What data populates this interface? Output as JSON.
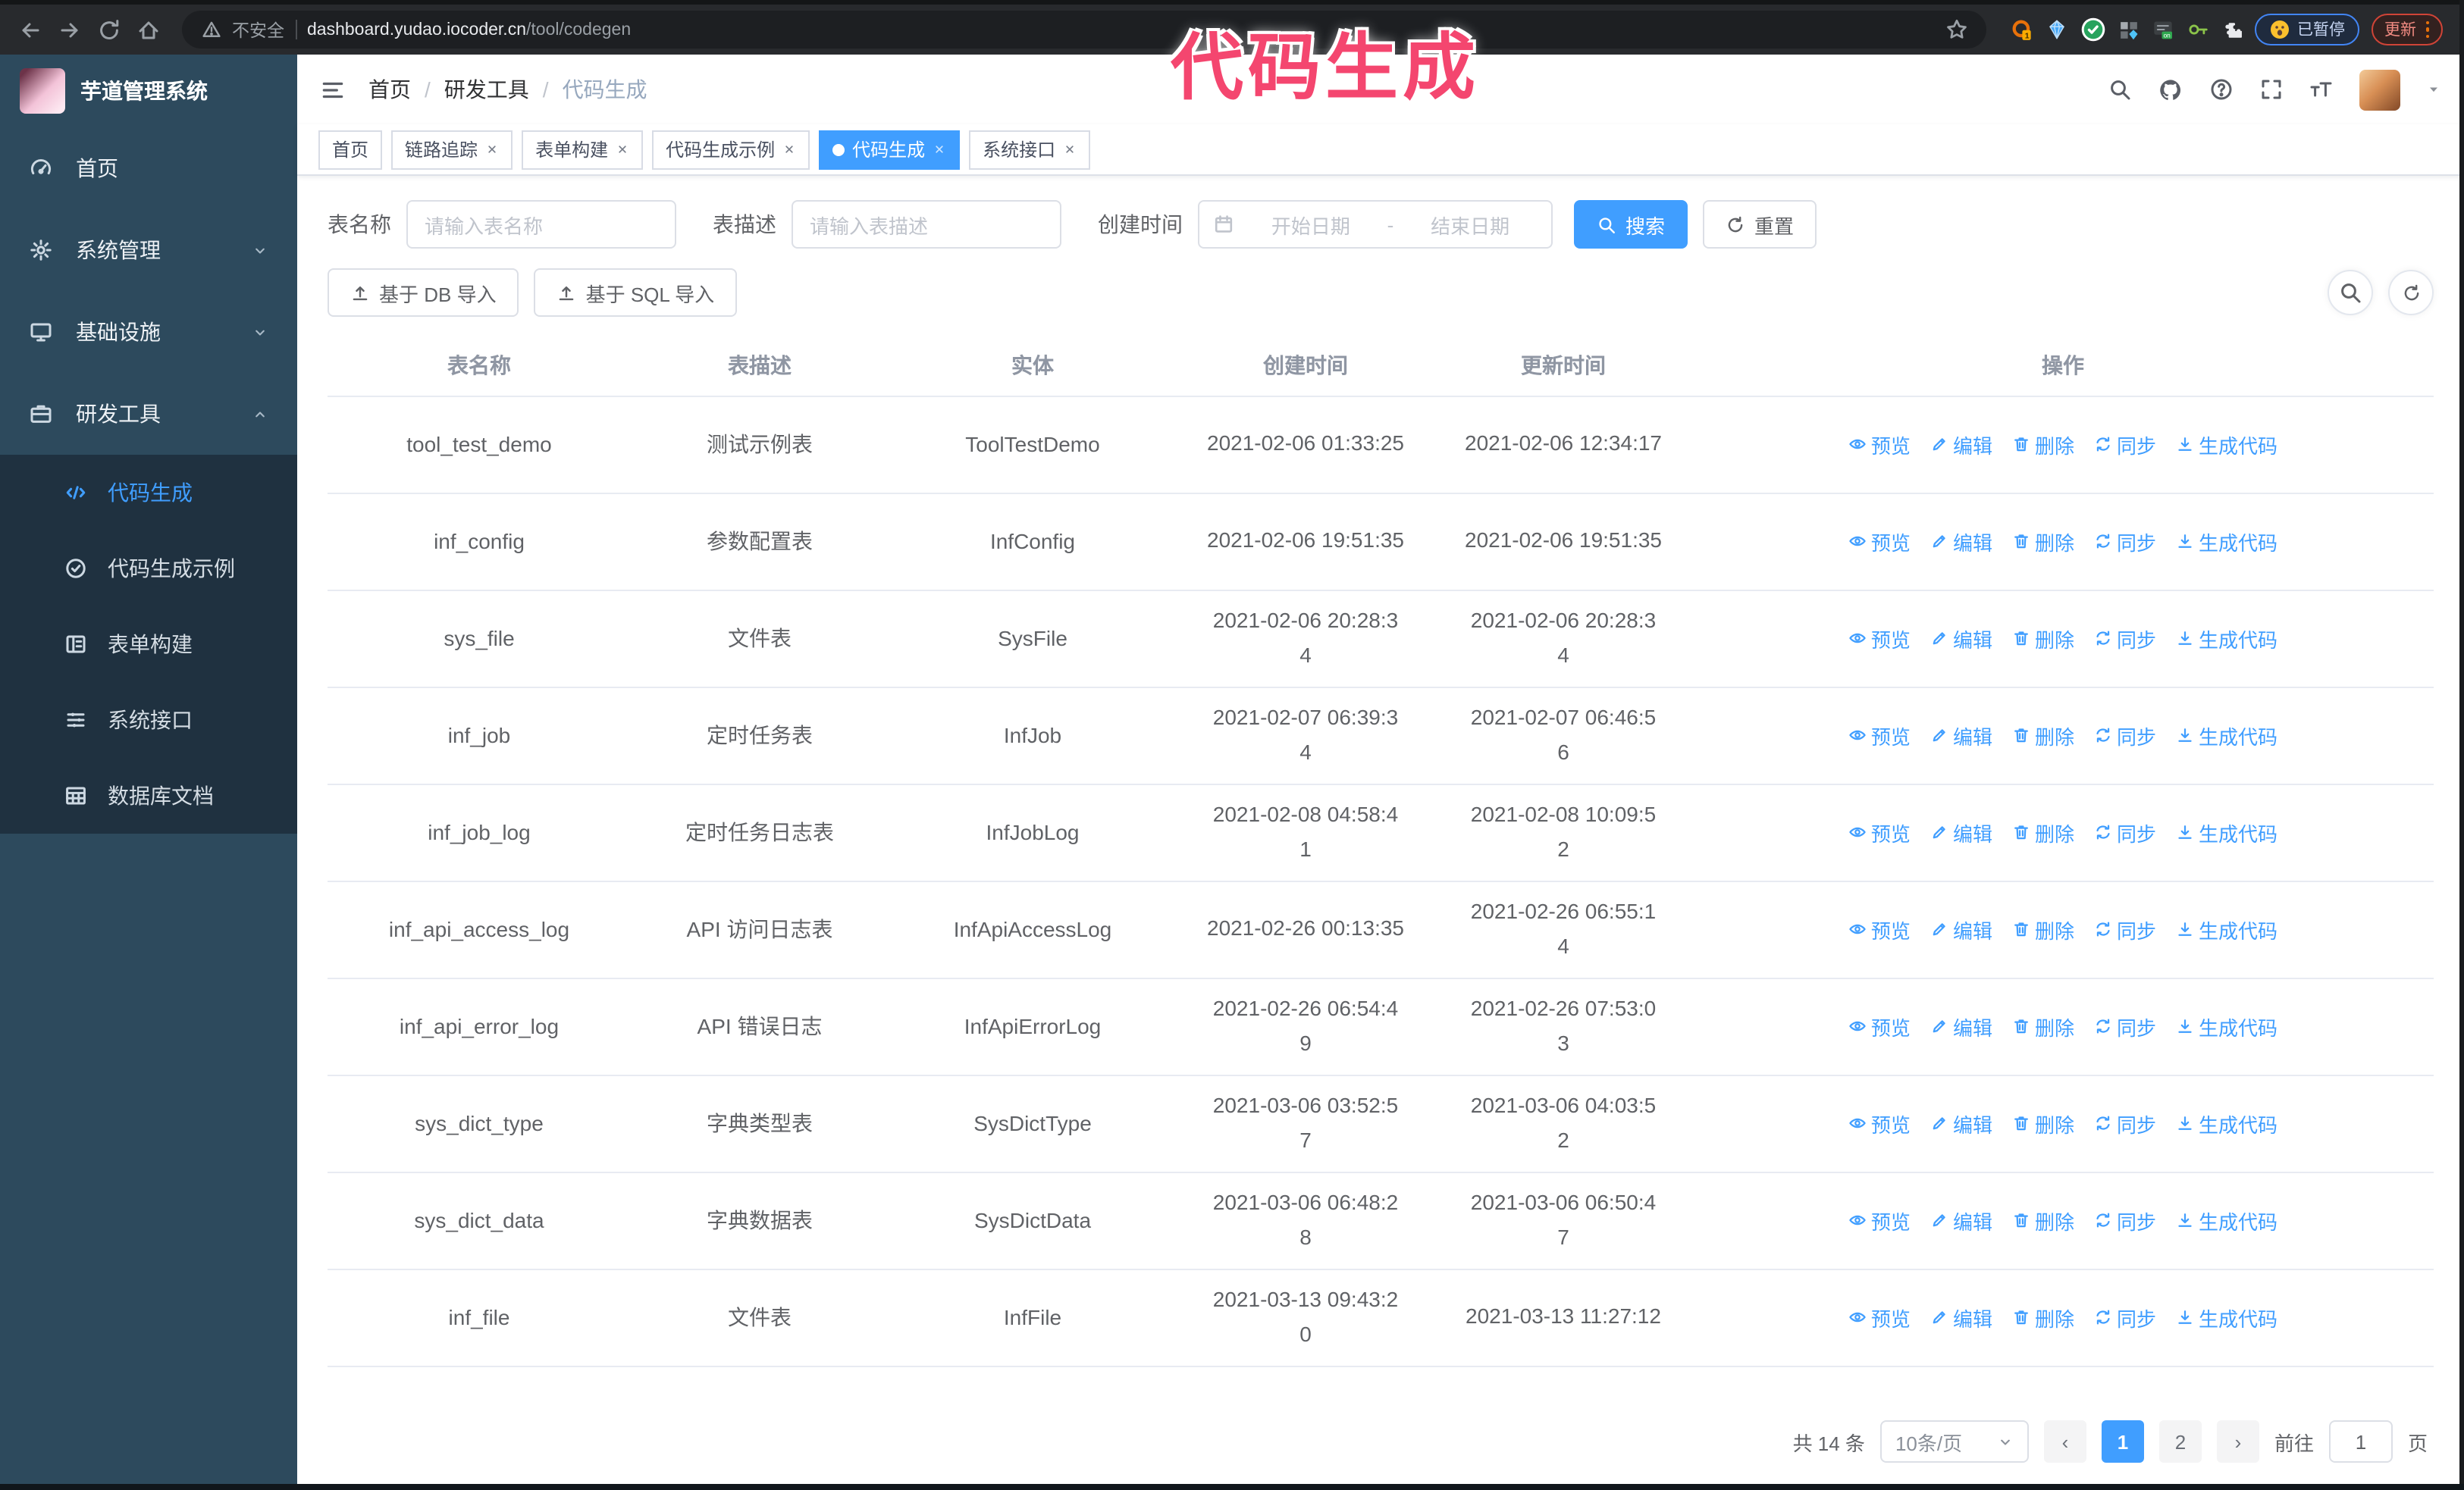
{
  "theme": {
    "primary": "#409eff",
    "annotation": "#f4466f",
    "sidebar_bg": "#2d4a5d",
    "submenu_bg": "#1f3140"
  },
  "annotation": {
    "text": "代码生成"
  },
  "browser": {
    "security_label": "不安全",
    "url_domain": "dashboard.yudao.iocoder.cn",
    "url_path": "/tool/codegen",
    "extension_badge": "1",
    "on_badge": "on",
    "paused_label": "已暂停",
    "update_label": "更新"
  },
  "sidebar": {
    "logo_title": "芋道管理系统",
    "items": [
      {
        "label": "首页",
        "icon": "gauge-icon",
        "chevron": ""
      },
      {
        "label": "系统管理",
        "icon": "gear-icon",
        "chevron": "down"
      },
      {
        "label": "基础设施",
        "icon": "monitor-icon",
        "chevron": "down"
      },
      {
        "label": "研发工具",
        "icon": "briefcase-icon",
        "chevron": "up"
      }
    ],
    "submenu": [
      {
        "label": "代码生成",
        "icon": "code-icon",
        "active": true
      },
      {
        "label": "代码生成示例",
        "icon": "badge-check-icon",
        "active": false
      },
      {
        "label": "表单构建",
        "icon": "form-icon",
        "active": false
      },
      {
        "label": "系统接口",
        "icon": "api-list-icon",
        "active": false
      },
      {
        "label": "数据库文档",
        "icon": "table-grid-icon",
        "active": false
      }
    ]
  },
  "header": {
    "breadcrumb": [
      "首页",
      "研发工具",
      "代码生成"
    ]
  },
  "tabs": [
    {
      "label": "首页",
      "closable": false,
      "active": false
    },
    {
      "label": "链路追踪",
      "closable": true,
      "active": false
    },
    {
      "label": "表单构建",
      "closable": true,
      "active": false
    },
    {
      "label": "代码生成示例",
      "closable": true,
      "active": false
    },
    {
      "label": "代码生成",
      "closable": true,
      "active": true
    },
    {
      "label": "系统接口",
      "closable": true,
      "active": false
    }
  ],
  "filters": {
    "table_name_label": "表名称",
    "table_name_placeholder": "请输入表名称",
    "table_desc_label": "表描述",
    "table_desc_placeholder": "请输入表描述",
    "create_time_label": "创建时间",
    "date_start_placeholder": "开始日期",
    "date_separator": "-",
    "date_end_placeholder": "结束日期",
    "search_label": "搜索",
    "reset_label": "重置"
  },
  "toolbar": {
    "import_db_label": "基于 DB 导入",
    "import_sql_label": "基于 SQL 导入"
  },
  "table": {
    "columns": [
      "表名称",
      "表描述",
      "实体",
      "创建时间",
      "更新时间",
      "操作"
    ],
    "action_labels": [
      "预览",
      "编辑",
      "删除",
      "同步",
      "生成代码"
    ],
    "rows": [
      {
        "name": "tool_test_demo",
        "desc": "测试示例表",
        "entity": "ToolTestDemo",
        "create_time": "2021-02-06 01:33:25",
        "update_time": "2021-02-06 12:34:17"
      },
      {
        "name": "inf_config",
        "desc": "参数配置表",
        "entity": "InfConfig",
        "create_time": "2021-02-06 19:51:35",
        "update_time": "2021-02-06 19:51:35"
      },
      {
        "name": "sys_file",
        "desc": "文件表",
        "entity": "SysFile",
        "create_time": [
          "2021-02-06 20:28:3",
          "4"
        ],
        "update_time": [
          "2021-02-06 20:28:3",
          "4"
        ]
      },
      {
        "name": "inf_job",
        "desc": "定时任务表",
        "entity": "InfJob",
        "create_time": [
          "2021-02-07 06:39:3",
          "4"
        ],
        "update_time": [
          "2021-02-07 06:46:5",
          "6"
        ]
      },
      {
        "name": "inf_job_log",
        "desc": "定时任务日志表",
        "entity": "InfJobLog",
        "create_time": [
          "2021-02-08 04:58:4",
          "1"
        ],
        "update_time": [
          "2021-02-08 10:09:5",
          "2"
        ]
      },
      {
        "name": "inf_api_access_log",
        "desc": "API 访问日志表",
        "entity": "InfApiAccessLog",
        "create_time": "2021-02-26 00:13:35",
        "update_time": [
          "2021-02-26 06:55:1",
          "4"
        ]
      },
      {
        "name": "inf_api_error_log",
        "desc": "API 错误日志",
        "entity": "InfApiErrorLog",
        "create_time": [
          "2021-02-26 06:54:4",
          "9"
        ],
        "update_time": [
          "2021-02-26 07:53:0",
          "3"
        ]
      },
      {
        "name": "sys_dict_type",
        "desc": "字典类型表",
        "entity": "SysDictType",
        "create_time": [
          "2021-03-06 03:52:5",
          "7"
        ],
        "update_time": [
          "2021-03-06 04:03:5",
          "2"
        ]
      },
      {
        "name": "sys_dict_data",
        "desc": "字典数据表",
        "entity": "SysDictData",
        "create_time": [
          "2021-03-06 06:48:2",
          "8"
        ],
        "update_time": [
          "2021-03-06 06:50:4",
          "7"
        ]
      },
      {
        "name": "inf_file",
        "desc": "文件表",
        "entity": "InfFile",
        "create_time": [
          "2021-03-13 09:43:2",
          "0"
        ],
        "update_time": "2021-03-13 11:27:12"
      }
    ]
  },
  "pagination": {
    "total_label": "共 14 条",
    "page_size": "10条/页",
    "pages": [
      "1",
      "2"
    ],
    "active_page": "1",
    "goto_label": "前往",
    "goto_value": "1",
    "goto_suffix": "页"
  }
}
